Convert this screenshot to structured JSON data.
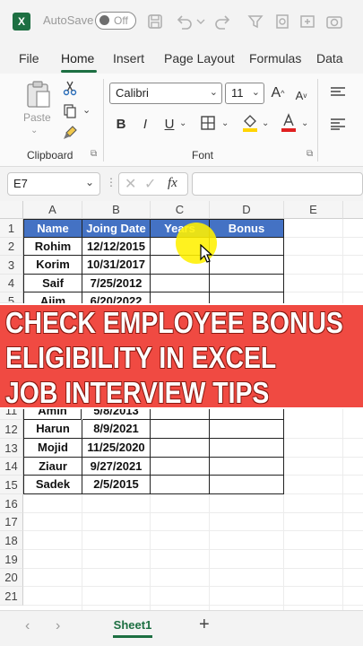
{
  "titlebar": {
    "app_letter": "X",
    "autosave_label": "AutoSave",
    "toggle_state": "Off"
  },
  "menu": {
    "tabs": [
      "File",
      "Home",
      "Insert",
      "Page Layout",
      "Formulas",
      "Data"
    ],
    "active": "Home"
  },
  "ribbon": {
    "clipboard": {
      "paste_label": "Paste",
      "group_label": "Clipboard"
    },
    "font": {
      "family": "Calibri",
      "size": "11",
      "grow_label": "A",
      "shrink_label": "A",
      "bold": "B",
      "italic": "I",
      "underline": "U",
      "group_label": "Font"
    }
  },
  "formula_bar": {
    "name_box": "E7",
    "fx_label": "fx",
    "formula": ""
  },
  "sheet": {
    "columns": [
      "A",
      "B",
      "C",
      "D",
      "E"
    ],
    "rows": [
      "1",
      "2",
      "3",
      "4",
      "5",
      "11",
      "12",
      "13",
      "14",
      "15",
      "16",
      "17",
      "18",
      "19",
      "20",
      "21"
    ],
    "header": [
      "Name",
      "Joing Date",
      "Years",
      "Bonus"
    ],
    "data": [
      [
        "Rohim",
        "12/12/2015"
      ],
      [
        "Korim",
        "10/31/2017"
      ],
      [
        "Saif",
        "7/25/2012"
      ],
      [
        "Ajim",
        "6/20/2022"
      ],
      [
        "Amin",
        "5/8/2013"
      ],
      [
        "Harun",
        "8/9/2021"
      ],
      [
        "Mojid",
        "11/25/2020"
      ],
      [
        "Ziaur",
        "9/27/2021"
      ],
      [
        "Sadek",
        "2/5/2015"
      ]
    ]
  },
  "banner": {
    "lines": [
      "CHECK EMPLOYEE BONUS",
      "ELIGIBILITY IN EXCEL",
      "JOB INTERVIEW TIPS"
    ]
  },
  "sheet_tabs": {
    "active": "Sheet1",
    "add": "+"
  },
  "colors": {
    "excel_green": "#1d6f42",
    "header_blue": "#4472c4",
    "banner_red": "#f04a42",
    "highlight_yellow": "#fff000"
  }
}
